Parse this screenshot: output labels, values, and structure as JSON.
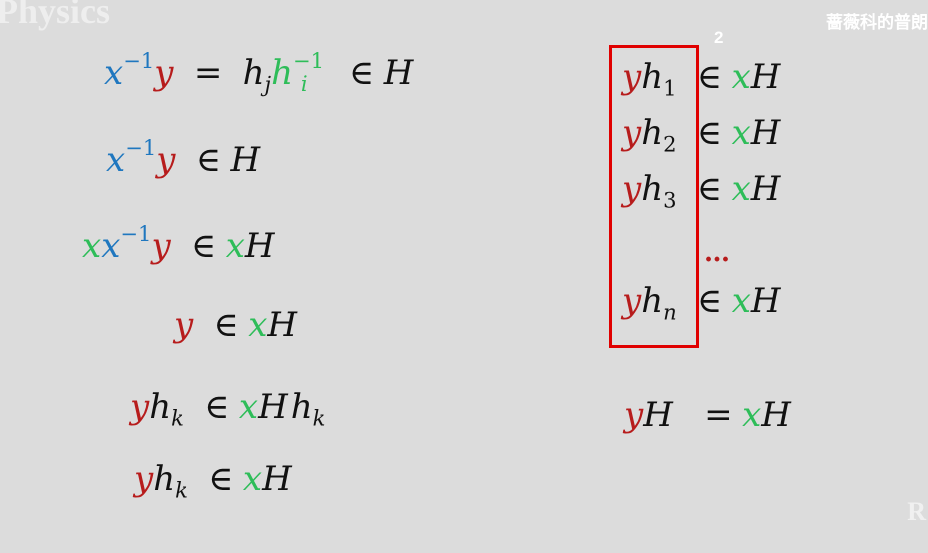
{
  "watermark": {
    "top_left": "Physics",
    "top_right": "蔷薇科的普朗",
    "bottom_right": "R",
    "page_number": "2"
  },
  "colors": {
    "x": "#1f77bf",
    "y": "#b71c1c",
    "h_green": "#2ebd59",
    "box": "#e00000",
    "background": "#dcdcdc"
  },
  "sym": {
    "x": "x",
    "y": "y",
    "h": "h",
    "H": "H",
    "inv": "−1",
    "elem": "∈",
    "eq": "=",
    "j": "j",
    "i": "i",
    "k": "k",
    "n": "n",
    "s1": "1",
    "s2": "2",
    "s3": "3",
    "dots": "…"
  }
}
